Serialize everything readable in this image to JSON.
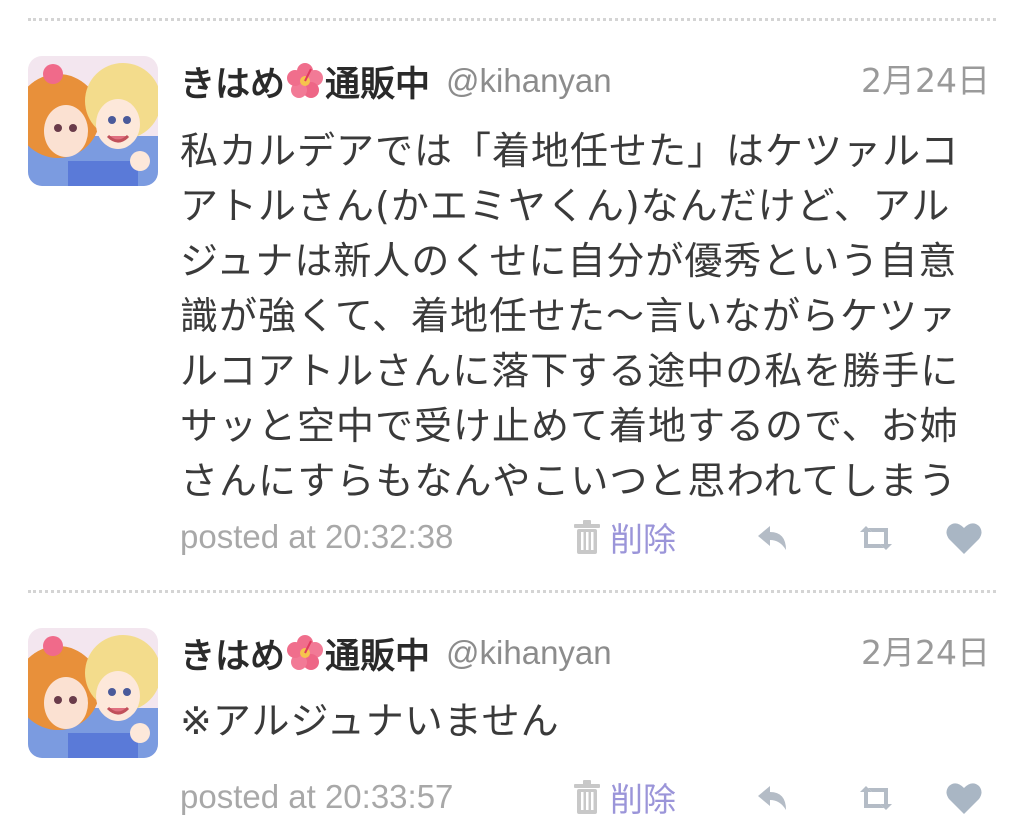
{
  "tweets": [
    {
      "author": {
        "name_part1": "きはめ",
        "name_part2": "通販中",
        "flower_icon": "hibiscus-icon",
        "handle": "@kihanyan"
      },
      "date": "2月24日",
      "lines": [
        "私カルデアでは「着地任せた」はケツァルコ",
        "アトルさん(かエミヤくん)なんだけど、アル",
        "ジュナは新人のくせに自分が優秀という自意",
        "識が強くて、着地任せた〜言いながらケツァ",
        "ルコアトルさんに落下する途中の私を勝手に",
        "サッと空中で受け止めて着地するので、お姉",
        "さんにすらもなんやこいつと思われてしまう"
      ],
      "posted": "posted at 20:32:38",
      "delete_label": "削除",
      "actions": [
        "reply-icon",
        "retweet-icon",
        "favorite-icon"
      ]
    },
    {
      "author": {
        "name_part1": "きはめ",
        "name_part2": "通販中",
        "flower_icon": "hibiscus-icon",
        "handle": "@kihanyan"
      },
      "date": "2月24日",
      "lines": [
        "※アルジュナいません"
      ],
      "posted": "posted at 20:33:57",
      "delete_label": "削除",
      "actions": [
        "reply-icon",
        "retweet-icon",
        "favorite-icon"
      ]
    }
  ],
  "colors": {
    "delete": "#9b95d9",
    "action_icons": "#b4bcc6",
    "favorite": "#a9b6c4",
    "divider": "#d4d4d4"
  }
}
